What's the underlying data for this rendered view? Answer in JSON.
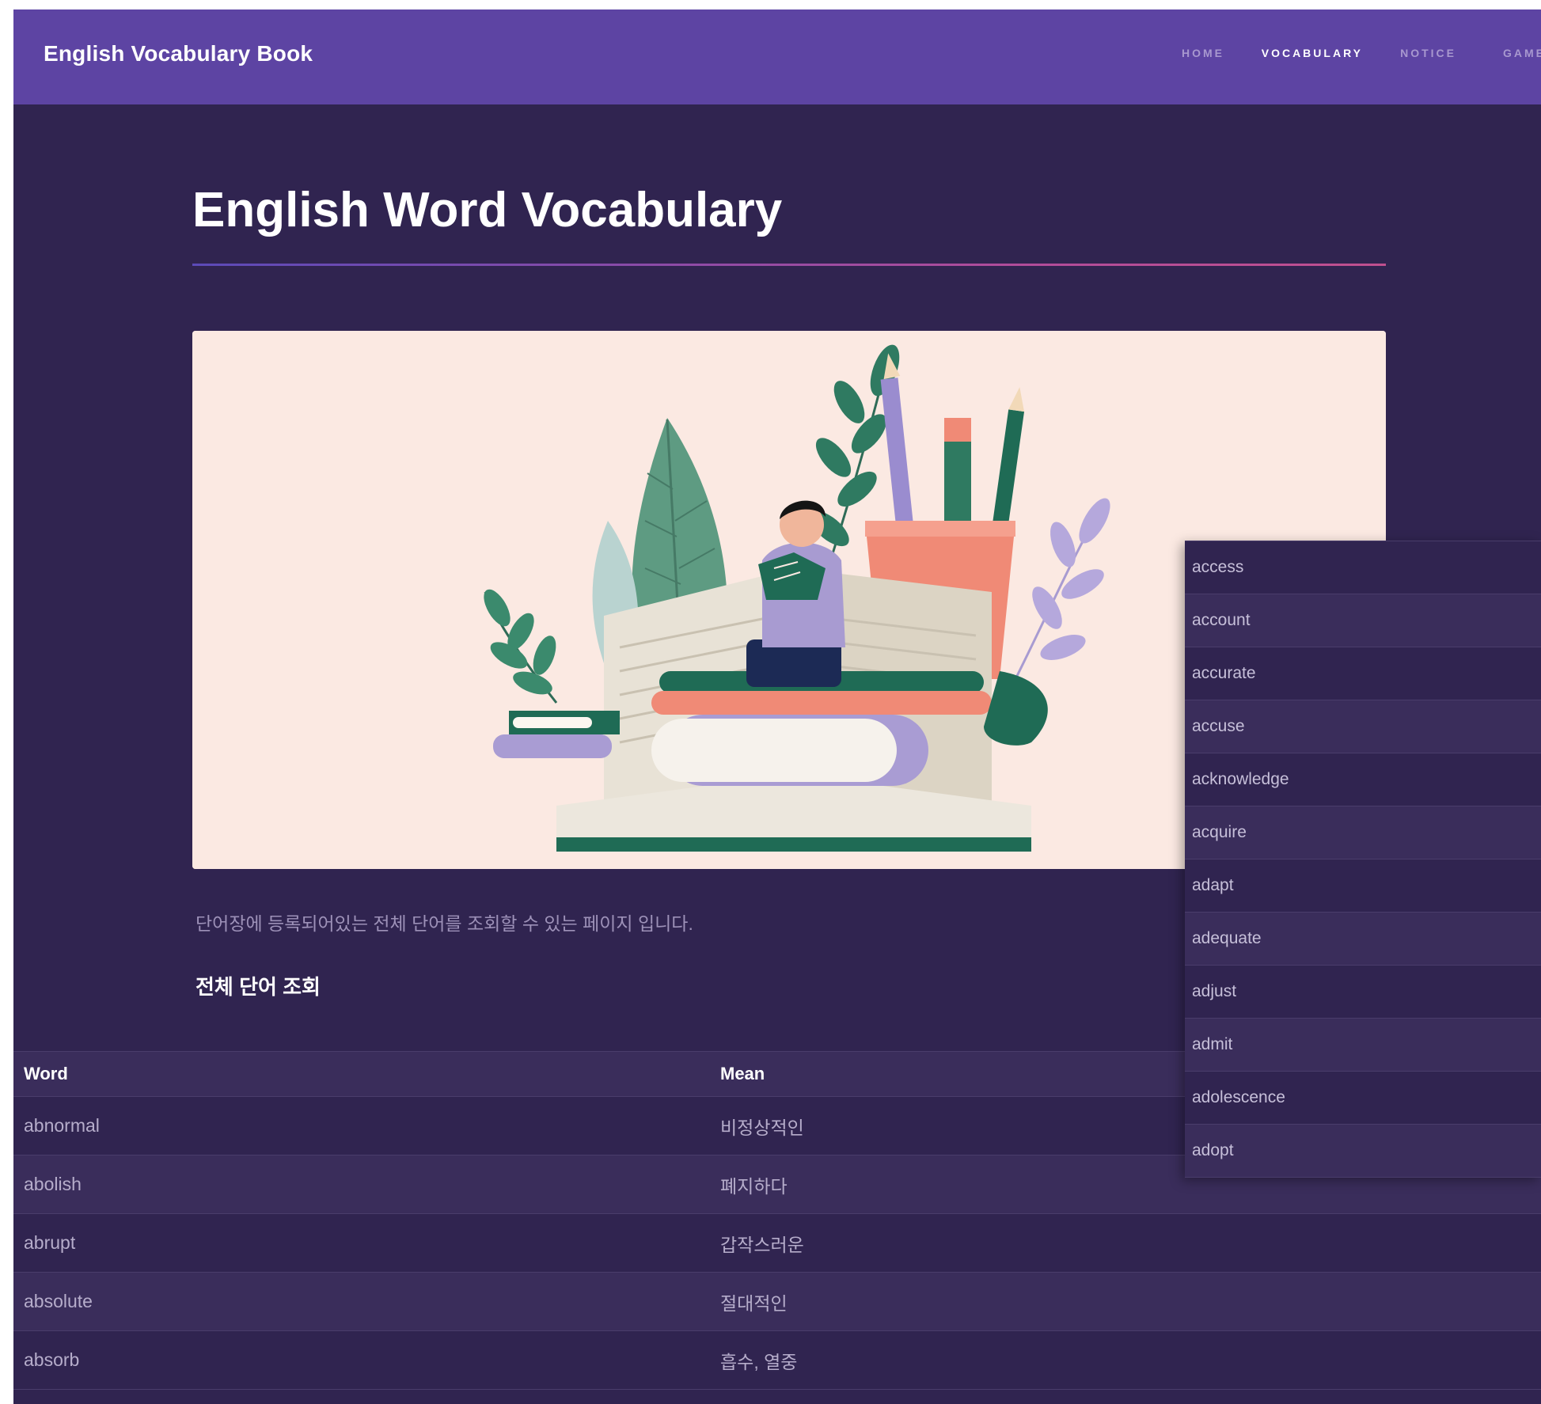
{
  "brand": "English Vocabulary Book",
  "nav": [
    {
      "label": "HOME",
      "active": false
    },
    {
      "label": "VOCABULARY",
      "active": true
    },
    {
      "label": "NOTICE",
      "active": false
    },
    {
      "label": "GAME",
      "active": false
    }
  ],
  "page_title": "English Word Vocabulary",
  "intro": "단어장에 등록되어있는 전체 단어를 조회할 수 있는 페이지 입니다.",
  "section_heading": "전체 단어 조회",
  "table": {
    "headers": [
      "Word",
      "Mean"
    ],
    "rows": [
      {
        "word": "abnormal",
        "mean": "비정상적인"
      },
      {
        "word": "abolish",
        "mean": "폐지하다"
      },
      {
        "word": "abrupt",
        "mean": "갑작스러운"
      },
      {
        "word": "absolute",
        "mean": "절대적인"
      },
      {
        "word": "absorb",
        "mean": "흡수, 열중"
      }
    ]
  },
  "dropdown": {
    "items": [
      "access",
      "account",
      "accurate",
      "accuse",
      "acknowledge",
      "acquire",
      "adapt",
      "adequate",
      "adjust",
      "admit",
      "adolescence",
      "adopt"
    ]
  },
  "colors": {
    "navbar": "#5d44a3",
    "page_background": "#302450",
    "accent_gradient": [
      "#5c4ab8",
      "#c0508f"
    ],
    "hero_background": "#fbe9e2"
  },
  "hero_icons": [
    "reading-person-illustration",
    "leaf-icon",
    "pencil-cup-icon",
    "stacked-books-icon",
    "open-book-icon"
  ]
}
